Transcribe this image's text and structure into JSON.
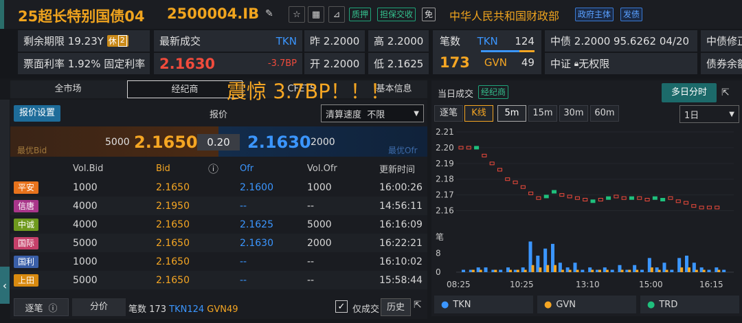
{
  "header": {
    "title": "25超长特别国债04",
    "code": "2500004.IB",
    "tags": [
      "质押",
      "担保交收",
      "免"
    ],
    "issuer": "中华人民共和国财政部",
    "issuer_tags": [
      "政府主体",
      "发债"
    ]
  },
  "quote": {
    "remaining_label": "剩余期限",
    "remaining_value": "19.23Y",
    "remaining_badge": "休",
    "remaining_badge_num": "2",
    "latest_label": "最新成交",
    "latest_source": "TKN",
    "latest_price": "2.1630",
    "latest_change": "-3.7BP",
    "coupon_label": "票面利率",
    "coupon_value": "1.92%",
    "coupon_type": "固定利率",
    "prev_label": "昨",
    "prev_value": "2.2000",
    "open_label": "开",
    "open_value": "2.2000",
    "high_label": "高",
    "high_value": "2.2000",
    "low_label": "低",
    "low_value": "2.1625",
    "trades_label": "笔数",
    "trades_total": "173",
    "tkn_label": "TKN",
    "tkn_count": "124",
    "gvn_label": "GVN",
    "gvn_count": "49",
    "cbond_label": "中债",
    "cbond_value": "2.2000 95.6262 04/20",
    "csi_label": "中证",
    "csi_value": "无权限",
    "cbond_fix": "中债修正",
    "bond_rest": "债券余额"
  },
  "overlay_text": "震惊 3.7BP！！！",
  "market_tabs": [
    "全市场",
    "经纪商",
    "CFETS",
    "基本信息"
  ],
  "quote_panel": {
    "settings": "报价设置",
    "title": "报价",
    "speed_label": "清算速度",
    "speed_value": "不限",
    "best_bid_label": "最优Bid",
    "best_bid_vol": "5000",
    "best_bid": "2.1650",
    "spread": "0.20",
    "best_ofr": "2.1630",
    "best_ofr_vol": "2000",
    "best_ofr_label": "最优Ofr",
    "columns": [
      "Vol.Bid",
      "Bid",
      "ⓘ",
      "Ofr",
      "Vol.Ofr",
      "更新时间"
    ],
    "rows": [
      {
        "broker": "平安",
        "color": "#e8731c",
        "vol_bid": "1000",
        "bid": "2.1650",
        "ofr": "2.1600",
        "vol_ofr": "1000",
        "time": "16:00:26"
      },
      {
        "broker": "信唐",
        "color": "#a9368a",
        "vol_bid": "4000",
        "bid": "2.1950",
        "ofr": "--",
        "vol_ofr": "--",
        "time": "14:56:11"
      },
      {
        "broker": "中诚",
        "color": "#6f9a1e",
        "vol_bid": "4000",
        "bid": "2.1650",
        "ofr": "2.1625",
        "vol_ofr": "5000",
        "time": "16:16:09"
      },
      {
        "broker": "国际",
        "color": "#c5406a",
        "vol_bid": "5000",
        "bid": "2.1650",
        "ofr": "2.1630",
        "vol_ofr": "2000",
        "time": "16:22:21"
      },
      {
        "broker": "国利",
        "color": "#3a5fa8",
        "vol_bid": "1000",
        "bid": "2.1650",
        "ofr": "--",
        "vol_ofr": "--",
        "time": "16:10:02"
      },
      {
        "broker": "上田",
        "color": "#d88a10",
        "vol_bid": "5000",
        "bid": "2.1650",
        "ofr": "--",
        "vol_ofr": "--",
        "time": "15:58:44"
      }
    ]
  },
  "bottom_bar": {
    "tick_btn": "逐笔",
    "price_btn": "分价",
    "trades_label": "笔数",
    "trades_total": "173",
    "tkn": "TKN",
    "tkn_count": "124",
    "gvn": "GVN",
    "gvn_count": "49",
    "only_deal": "仅成交",
    "history": "历史"
  },
  "chart_panel": {
    "title": "当日成交",
    "broker_tag": "经纪商",
    "multi_day": "多日分时",
    "tick": "逐笔",
    "kline": "K线",
    "intervals": [
      "5m",
      "15m",
      "30m",
      "60m"
    ],
    "period": "1日",
    "legend": [
      "TKN",
      "GVN",
      "TRD"
    ],
    "legend_colors": [
      "#3b96ff",
      "#f5a623",
      "#1fc07d"
    ]
  },
  "chart_data": {
    "type": "candlestick+bar",
    "x_ticks": [
      "08:25",
      "10:25",
      "13:10",
      "15:00",
      "16:15"
    ],
    "price_ticks": [
      "2.21",
      "2.20",
      "2.19",
      "2.18",
      "2.17",
      "2.16"
    ],
    "price_ylim": [
      2.155,
      2.21
    ],
    "volume_label": "笔",
    "volume_ticks": [
      "8",
      "0"
    ],
    "volume_ylim": [
      0,
      14
    ],
    "candles": [
      {
        "c": 2.2,
        "up": 0
      },
      {
        "c": 2.2,
        "up": 0
      },
      {
        "c": 2.2,
        "up": 1
      },
      {
        "c": 2.195,
        "up": 0
      },
      {
        "c": 2.19,
        "up": 0
      },
      {
        "c": 2.186,
        "up": 0
      },
      {
        "c": 2.18,
        "up": 0
      },
      {
        "c": 2.178,
        "up": 0
      },
      {
        "c": 2.175,
        "up": 0
      },
      {
        "c": 2.171,
        "up": 0
      },
      {
        "c": 2.168,
        "up": 0
      },
      {
        "c": 2.169,
        "up": 1
      },
      {
        "c": 2.172,
        "up": 1
      },
      {
        "c": 2.17,
        "up": 0
      },
      {
        "c": 2.169,
        "up": 0
      },
      {
        "c": 2.168,
        "up": 0
      },
      {
        "c": 2.167,
        "up": 0
      },
      {
        "c": 2.166,
        "up": 1
      },
      {
        "c": 2.167,
        "up": 0
      },
      {
        "c": 2.168,
        "up": 1
      },
      {
        "c": 2.169,
        "up": 0
      },
      {
        "c": 2.168,
        "up": 0
      },
      {
        "c": 2.168,
        "up": 1
      },
      {
        "c": 2.168,
        "up": 0
      },
      {
        "c": 2.167,
        "up": 0
      },
      {
        "c": 2.168,
        "up": 1
      },
      {
        "c": 2.167,
        "up": 1
      },
      {
        "c": 2.168,
        "up": 0
      },
      {
        "c": 2.166,
        "up": 0
      },
      {
        "c": 2.165,
        "up": 0
      },
      {
        "c": 2.163,
        "up": 0
      },
      {
        "c": 2.162,
        "up": 0
      },
      {
        "c": 2.162,
        "up": 0
      },
      {
        "c": 2.162,
        "up": 0
      }
    ],
    "volume_tkn": [
      1,
      1,
      2,
      2,
      1,
      1,
      2,
      1,
      2,
      13,
      7,
      10,
      12,
      4,
      2,
      4,
      1,
      2,
      1,
      2,
      1,
      3,
      1,
      3,
      1,
      6,
      2,
      4,
      1,
      6,
      7,
      4,
      2,
      1,
      2,
      1
    ],
    "volume_gvn": [
      0,
      1,
      1,
      0,
      1,
      0,
      1,
      1,
      1,
      3,
      2,
      3,
      3,
      1,
      1,
      1,
      0,
      1,
      1,
      1,
      0,
      1,
      1,
      1,
      0,
      2,
      1,
      1,
      0,
      2,
      2,
      1,
      1,
      0,
      1,
      0
    ]
  }
}
